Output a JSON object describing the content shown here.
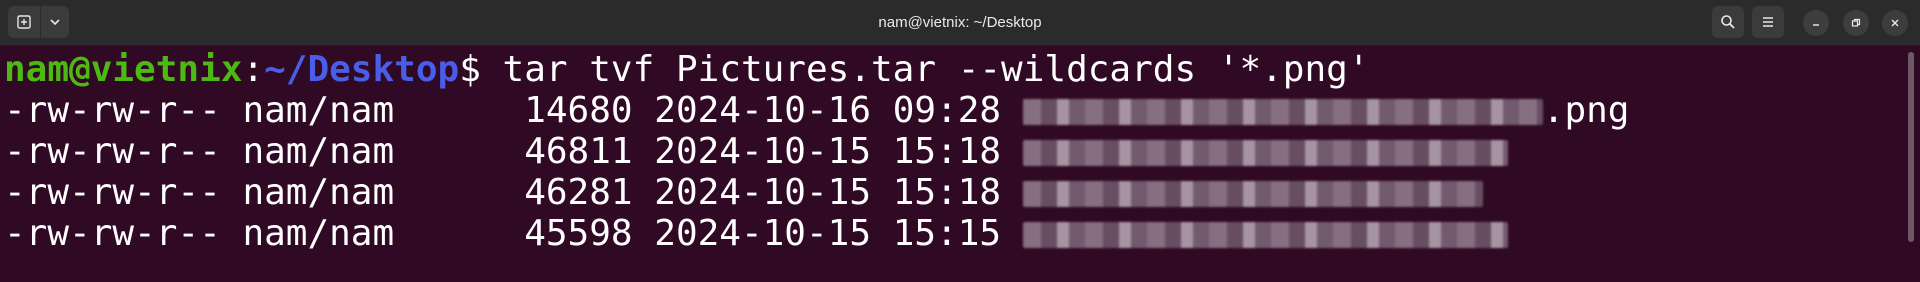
{
  "window": {
    "title": "nam@vietnix: ~/Desktop",
    "new_tab_icon": "new-tab-icon",
    "menu_caret_icon": "chevron-down-icon",
    "search_icon": "search-icon",
    "menu_icon": "hamburger-icon"
  },
  "prompt": {
    "user_host": "nam@vietnix",
    "colon": ":",
    "path": "~/Desktop",
    "symbol": "$",
    "command": " tar tvf Pictures.tar --wildcards '*.png'"
  },
  "listing": [
    {
      "perms": "-rw-rw-r--",
      "owner": "nam/nam",
      "size": "14680",
      "date": "2024-10-16",
      "time": "09:28",
      "suffix": ".png"
    },
    {
      "perms": "-rw-rw-r--",
      "owner": "nam/nam",
      "size": "46811",
      "date": "2024-10-15",
      "time": "15:18",
      "suffix": ""
    },
    {
      "perms": "-rw-rw-r--",
      "owner": "nam/nam",
      "size": "46281",
      "date": "2024-10-15",
      "time": "15:18",
      "suffix": ""
    },
    {
      "perms": "-rw-rw-r--",
      "owner": "nam/nam",
      "size": "45598",
      "date": "2024-10-15",
      "time": "15:15",
      "suffix": ""
    }
  ],
  "colors": {
    "background": "#300a24",
    "user_host": "#4dba13",
    "path": "#4a5de8",
    "titlebar": "#2b2b2b"
  }
}
